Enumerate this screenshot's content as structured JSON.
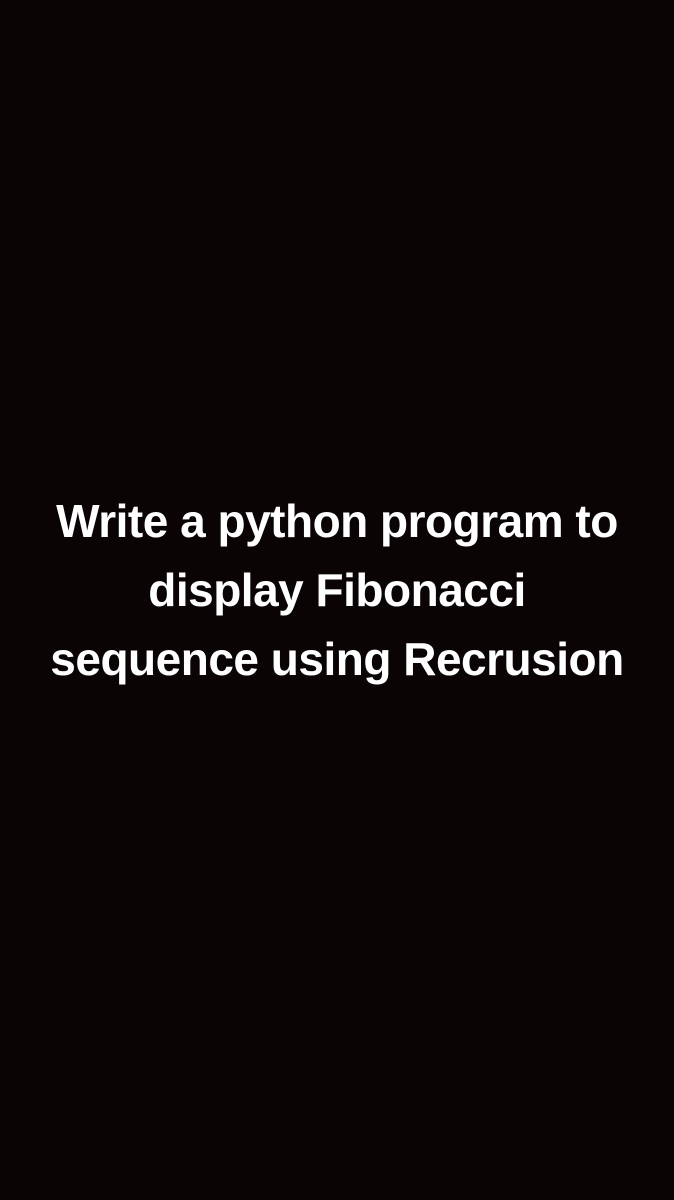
{
  "content": {
    "text": "Write a python program to display Fibonacci sequence using Recrusion"
  }
}
